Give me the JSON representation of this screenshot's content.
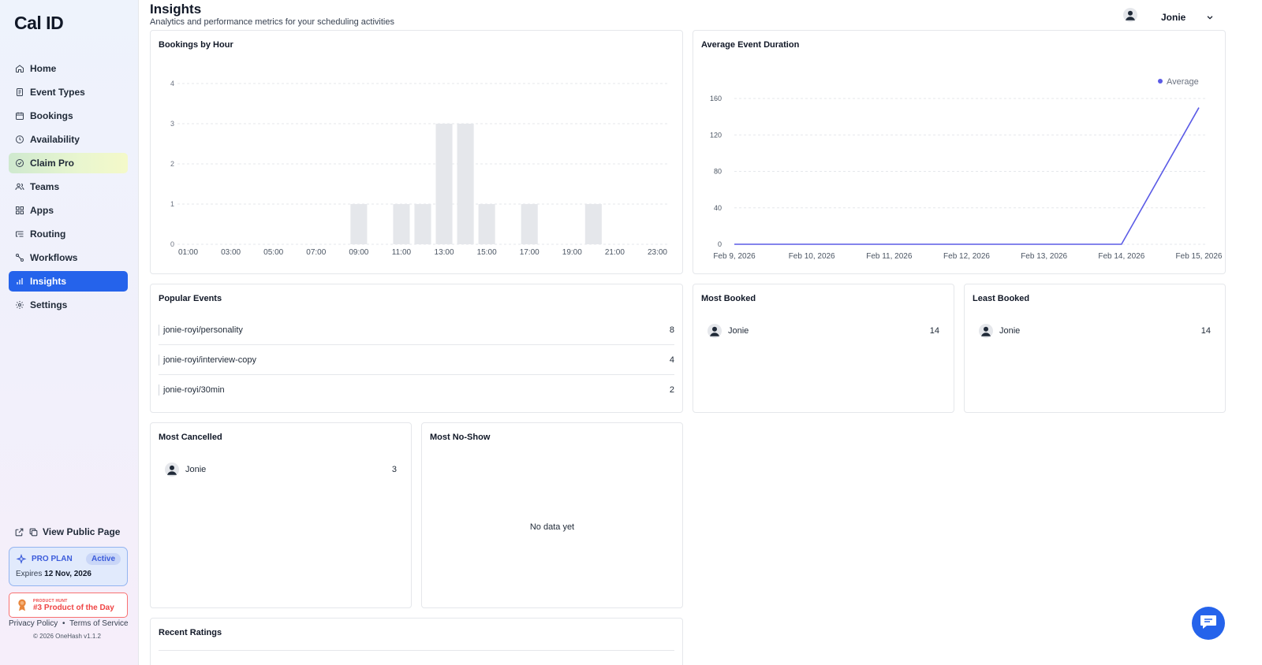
{
  "app": {
    "logo": "Cal ID"
  },
  "sidebar": {
    "items": [
      {
        "label": "Home",
        "icon": "home-icon"
      },
      {
        "label": "Event Types",
        "icon": "event-types-icon"
      },
      {
        "label": "Bookings",
        "icon": "calendar-icon"
      },
      {
        "label": "Availability",
        "icon": "clock-icon"
      },
      {
        "label": "Claim Pro",
        "icon": "badge-icon"
      },
      {
        "label": "Teams",
        "icon": "users-icon"
      },
      {
        "label": "Apps",
        "icon": "grid-icon"
      },
      {
        "label": "Routing",
        "icon": "routing-icon"
      },
      {
        "label": "Workflows",
        "icon": "workflow-icon"
      },
      {
        "label": "Insights",
        "icon": "bar-chart-icon",
        "active": true
      },
      {
        "label": "Settings",
        "icon": "gear-icon"
      }
    ],
    "public_page": "View Public Page",
    "plan": {
      "title": "PRO PLAN",
      "status": "Active",
      "expires_label": "Expires",
      "expires_date": "12 Nov, 2026"
    },
    "product_hunt": {
      "small": "PRODUCT HUNT",
      "big": "#3 Product of the Day"
    },
    "privacy": "Privacy Policy",
    "bullet": "•",
    "terms": "Terms of Service",
    "copyright": "© 2026 OneHash v1.1.2"
  },
  "header": {
    "title": "Insights",
    "subtitle": "Analytics and performance metrics for your scheduling activities",
    "user_name": "Jonie"
  },
  "colors": {
    "accent": "#2563eb",
    "bar": "#e5e7eb",
    "line": "#5b5be6"
  },
  "cards": {
    "bookings_by_hour": "Bookings by Hour",
    "avg_duration": "Average Event Duration",
    "popular_events": "Popular Events",
    "most_booked": "Most Booked",
    "least_booked": "Least Booked",
    "most_cancelled": "Most Cancelled",
    "most_no_show": "Most No-Show",
    "recent_ratings": "Recent Ratings",
    "no_data": "No data yet"
  },
  "popular_events": [
    {
      "name": "jonie-royi/personality",
      "count": "8"
    },
    {
      "name": "jonie-royi/interview-copy",
      "count": "4"
    },
    {
      "name": "jonie-royi/30min",
      "count": "2"
    }
  ],
  "most_booked": {
    "name": "Jonie",
    "count": "14"
  },
  "least_booked": {
    "name": "Jonie",
    "count": "14"
  },
  "most_cancelled": {
    "name": "Jonie",
    "count": "3"
  },
  "chart_data": [
    {
      "type": "bar",
      "title": "Bookings by Hour",
      "categories": [
        "01:00",
        "02:00",
        "03:00",
        "04:00",
        "05:00",
        "06:00",
        "07:00",
        "08:00",
        "09:00",
        "10:00",
        "11:00",
        "12:00",
        "13:00",
        "14:00",
        "15:00",
        "16:00",
        "17:00",
        "18:00",
        "19:00",
        "20:00",
        "21:00",
        "22:00",
        "23:00"
      ],
      "tick_labels": [
        "01:00",
        "03:00",
        "05:00",
        "07:00",
        "09:00",
        "11:00",
        "13:00",
        "15:00",
        "17:00",
        "19:00",
        "21:00",
        "23:00"
      ],
      "values": [
        0,
        0,
        0,
        0,
        0,
        0,
        0,
        0,
        1,
        0,
        1,
        1,
        3,
        3,
        1,
        0,
        1,
        0,
        0,
        1,
        0,
        0,
        0
      ],
      "yticks": [
        0,
        1,
        2,
        3,
        4
      ],
      "ylim": [
        0,
        4
      ],
      "grid": true
    },
    {
      "type": "line",
      "title": "Average Event Duration",
      "x": [
        "Feb 9, 2026",
        "Feb 10, 2026",
        "Feb 11, 2026",
        "Feb 12, 2026",
        "Feb 13, 2026",
        "Feb 14, 2026",
        "Feb 15, 2026"
      ],
      "series": [
        {
          "name": "Average",
          "values": [
            0,
            0,
            0,
            0,
            0,
            0,
            150
          ]
        }
      ],
      "yticks": [
        0,
        40,
        80,
        120,
        160
      ],
      "ylim": [
        0,
        160
      ],
      "grid": true,
      "legend": "top-right"
    }
  ]
}
